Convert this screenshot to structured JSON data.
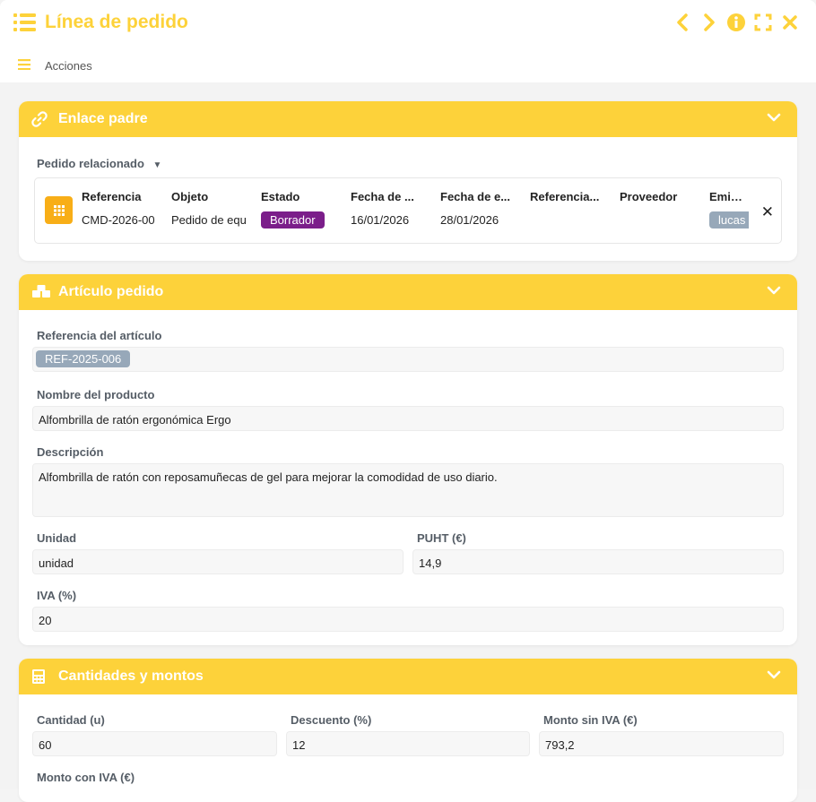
{
  "window": {
    "title": "Línea de pedido",
    "actions_label": "Acciones"
  },
  "colors": {
    "accent": "#fdd23a",
    "tile": "#f8ae17",
    "status": "#7b1e8a",
    "chip": "#97a8b9"
  },
  "parent": {
    "section_title": "Enlace padre",
    "related_label": "Pedido relacionado",
    "columns": [
      "Referencia",
      "Objeto",
      "Estado",
      "Fecha de ...",
      "Fecha de e...",
      "Referencia...",
      "Proveedor",
      "Emisor"
    ],
    "row": {
      "referencia": "CMD-2026-00",
      "objeto": "Pedido de equ",
      "estado": "Borrador",
      "fecha1": "16/01/2026",
      "fecha2": "28/01/2026",
      "referencia2": "",
      "proveedor": "",
      "emisor": "lucas"
    }
  },
  "article": {
    "section_title": "Artículo pedido",
    "ref_label": "Referencia del artículo",
    "ref_value": "REF-2025-006",
    "name_label": "Nombre del producto",
    "name_value": "Alfombrilla de ratón ergonómica Ergo",
    "desc_label": "Descripción",
    "desc_value": "Alfombrilla de ratón con reposamuñecas de gel para mejorar la comodidad de uso diario.",
    "unit_label": "Unidad",
    "unit_value": "unidad",
    "puht_label": "PUHT (€)",
    "puht_value": "14,9",
    "iva_label": "IVA (%)",
    "iva_value": "20"
  },
  "amounts": {
    "section_title": "Cantidades y montos",
    "qty_label": "Cantidad (u)",
    "qty_value": "60",
    "disc_label": "Descuento (%)",
    "disc_value": "12",
    "net_label": "Monto sin IVA (€)",
    "net_value": "793,2",
    "gross_label": "Monto con IVA (€)"
  }
}
